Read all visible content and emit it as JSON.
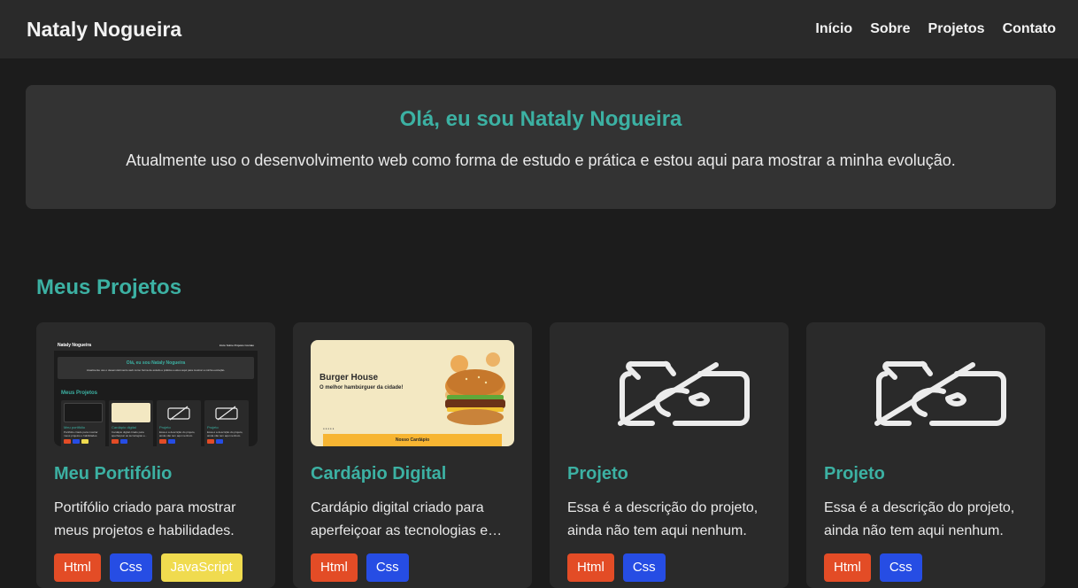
{
  "header": {
    "brand": "Nataly Nogueira",
    "nav": [
      "Início",
      "Sobre",
      "Projetos",
      "Contato"
    ]
  },
  "hero": {
    "title": "Olá, eu sou Nataly Nogueira",
    "text": "Atualmente uso o desenvolvimento web como forma de estudo e prática e estou aqui para mostrar a minha evolução."
  },
  "projects": {
    "title": "Meus Projetos",
    "cards": [
      {
        "title": "Meu Portifólio",
        "desc": "Portifólio criado para mostrar meus projetos e habilidades.",
        "tags": [
          "Html",
          "Css",
          "JavaScript"
        ],
        "thumb": "portfolio-preview",
        "mini": {
          "brand": "Nataly Nogueira",
          "nav": "Início Sobre Projetos Contato",
          "hero_title": "Olá, eu sou Nataly Nogueira",
          "hero_text": "Atualmente uso o desenvolvimento web como forma de estudo e prática e estou aqui para mostrar a minha evolução.",
          "section": "Meus Projetos",
          "cards": [
            {
              "t": "Meu portifólio",
              "d": "Portifólio criado para mostrar meus projetos e habilidades."
            },
            {
              "t": "Cardápio digital",
              "d": "Cardápio digital criado para aperfeiçoar as tecnologias e..."
            },
            {
              "t": "Projeto",
              "d": "Essa é a descrição do projeto, ainda não tem aqui nenhum."
            },
            {
              "t": "Projeto",
              "d": "Essa é a descrição do projeto, ainda não tem aqui nenhum."
            }
          ]
        }
      },
      {
        "title": "Cardápio Digital",
        "desc": "Cardápio digital criado para aperfeiçoar as tecnologias e…",
        "tags": [
          "Html",
          "Css"
        ],
        "thumb": "burger-preview",
        "burger": {
          "title": "Burger House",
          "subtitle": "O melhor hambúrguer da cidade!",
          "bar": "Nosso Cardápio"
        }
      },
      {
        "title": "Projeto",
        "desc": "Essa é a descrição do projeto, ainda não tem aqui nenhum.",
        "tags": [
          "Html",
          "Css"
        ],
        "thumb": "no-image"
      },
      {
        "title": "Projeto",
        "desc": "Essa é a descrição do projeto, ainda não tem aqui nenhum.",
        "tags": [
          "Html",
          "Css"
        ],
        "thumb": "no-image"
      }
    ]
  },
  "colors": {
    "accent": "#3cb1a3",
    "html": "#e34c26",
    "css": "#264de4",
    "js": "#f0db4f"
  },
  "icons": {
    "no_image": "camera-off-icon"
  }
}
